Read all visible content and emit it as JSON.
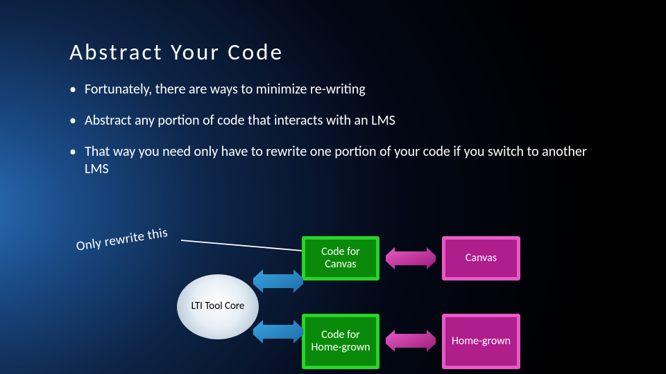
{
  "title": "Abstract Your Code",
  "bullets": [
    "Fortunately, there are ways to minimize re-writing",
    "Abstract any portion of code that interacts with an LMS",
    "That way you need only have to rewrite one portion of your code if you switch to another LMS"
  ],
  "callout": "Only rewrite this",
  "boxes": {
    "core": "LTI Tool Core",
    "code_canvas": "Code for Canvas",
    "canvas": "Canvas",
    "code_homegrown": "Code for Home-grown",
    "homegrown": "Home-grown"
  }
}
